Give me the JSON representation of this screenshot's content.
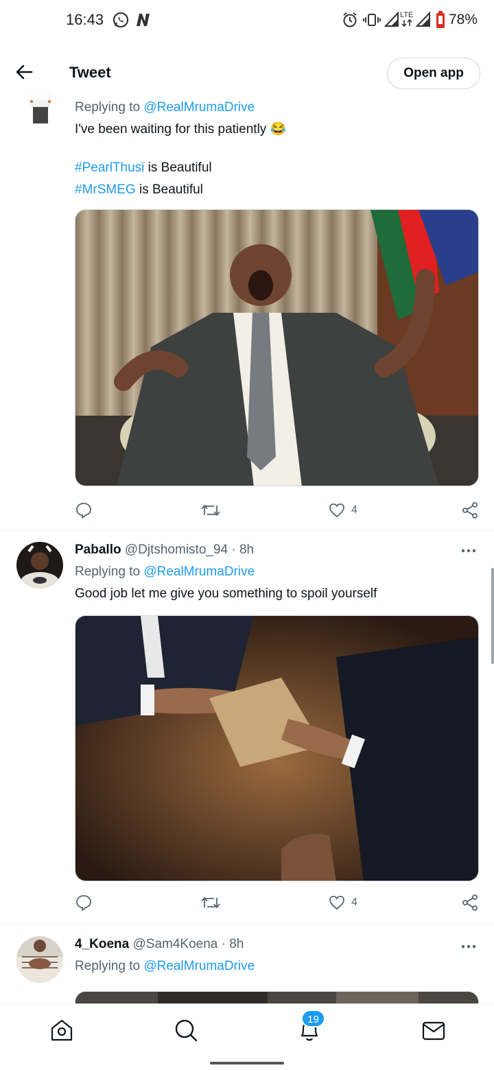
{
  "status_bar": {
    "time": "16:43",
    "battery": "78%",
    "icons": [
      "whatsapp-icon",
      "n-app-icon",
      "alarm-icon",
      "vibrate-icon",
      "signal-icon",
      "lte-icon",
      "signal-icon-2",
      "battery-icon"
    ]
  },
  "header": {
    "title": "Tweet",
    "open_app": "Open app"
  },
  "tweets": [
    {
      "replying_prefix": "Replying to ",
      "replying_to": "@RealMrumaDrive",
      "text": "I've been waiting for this patiently",
      "emoji": "😂",
      "hashtag_1": "#PearlThusi",
      "hashtag_1_suffix": " is Beautiful",
      "hashtag_2": "#MrSMEG",
      "hashtag_2_suffix": " is Beautiful",
      "likes": "4"
    },
    {
      "name": "Paballo",
      "handle": "@Djtshomisto_94",
      "time": " · 8h",
      "replying_prefix": "Replying to ",
      "replying_to": "@RealMrumaDrive",
      "text": "Good job let me give you something to spoil yourself",
      "likes": "4"
    },
    {
      "name": "4_Koena",
      "handle": "@Sam4Koena",
      "time": " · 8h",
      "replying_prefix": "Replying to ",
      "replying_to": "@RealMrumaDrive"
    }
  ],
  "bottom_nav": {
    "notifications_badge": "19"
  },
  "colors": {
    "link": "#1d9bf0",
    "muted": "#536471",
    "text": "#0f1419"
  }
}
